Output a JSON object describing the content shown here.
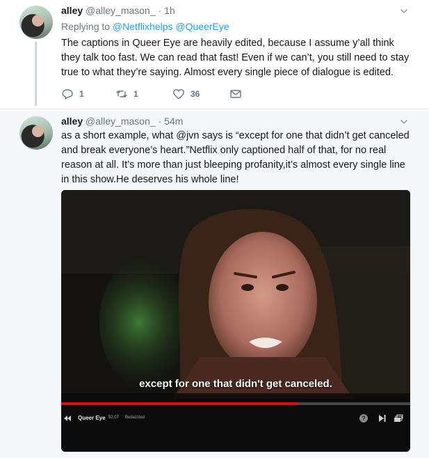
{
  "tweets": [
    {
      "name": "alley",
      "handle": "@alley_mason_",
      "dot": "·",
      "time": "1h",
      "replying_label": "Replying to",
      "replying_to_1": "@Netflixhelps",
      "replying_to_2": "@QueerEye",
      "text": "The captions in Queer Eye are heavily edited, because I assume y’all think they talk too fast. We can read that fast! Even if we can’t, you still need to stay true to what they’re saying. Almost every single piece of dialogue is edited.",
      "reply_count": "1",
      "retweet_count": "1",
      "like_count": "36"
    },
    {
      "name": "alley",
      "handle": "@alley_mason_",
      "dot": "·",
      "time": "54m",
      "text": "as a short example, what @jvn says is “except for one that didn’t get canceled and break everyone’s heart.”Netflix only captioned half of that, for no real reason at all. It’s more than just bleeping profanity,it’s almost every single line in this show.He deserves his whole line!",
      "media": {
        "caption": "except for one that didn't get canceled.",
        "player_title": "Queer Eye",
        "player_time": "52:07",
        "player_episode": "Bedazzled",
        "progress_fraction": 0.68
      }
    }
  ],
  "icons": [
    "chevron-down-icon",
    "reply-icon",
    "retweet-icon",
    "like-icon",
    "message-icon",
    "help-icon",
    "next-episode-icon",
    "episodes-icon",
    "rewind-icon"
  ],
  "colors": {
    "accent": "#1da1f2",
    "muted": "#657786",
    "progress": "#e50914"
  }
}
